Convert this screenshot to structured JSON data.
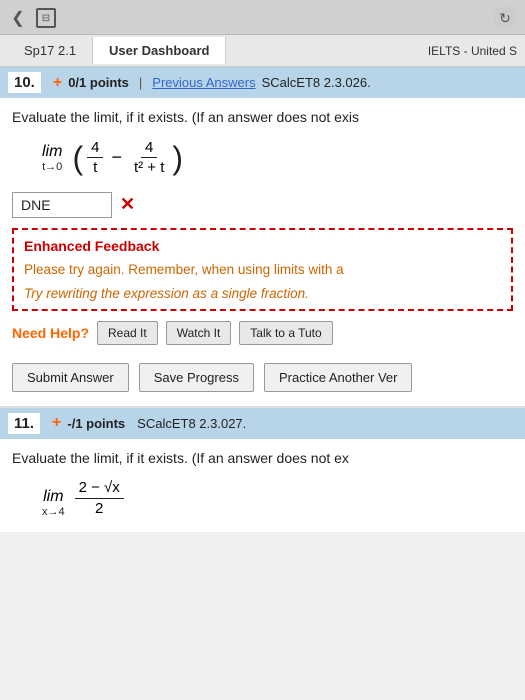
{
  "browser": {
    "back_icon": "❮",
    "tabs_icon": "⊞",
    "refresh_icon": "↻"
  },
  "nav": {
    "tab1": "Sp17 2.1",
    "tab2": "User Dashboard",
    "tab3": "IELTS - United S"
  },
  "question10": {
    "number": "10.",
    "plus_icon": "+",
    "points": "0/1 points",
    "divider": "|",
    "prev_answers_label": "Previous Answers",
    "source": "SCalcET8 2.3.026.",
    "question_text": "Evaluate the limit, if it exists. (If an answer does not exis",
    "lim_label": "lim",
    "lim_subscript": "t→0",
    "frac1_num": "4",
    "frac1_den": "t",
    "minus": "−",
    "frac2_num": "4",
    "frac2_den": "t² + t",
    "answer_value": "DNE",
    "wrong_mark": "✕",
    "feedback_title": "Enhanced Feedback",
    "feedback_text": "Please try again. Remember, when using limits with a",
    "feedback_hint": "Try rewriting the expression as a single fraction.",
    "need_help_label": "Need Help?",
    "btn_read": "Read It",
    "btn_watch": "Watch It",
    "btn_talk": "Talk to a Tuto",
    "btn_submit": "Submit Answer",
    "btn_save": "Save Progress",
    "btn_practice": "Practice Another Ver"
  },
  "question11": {
    "number": "11.",
    "plus_icon": "+",
    "points": "-/1 points",
    "source": "SCalcET8 2.3.027.",
    "question_text": "Evaluate the limit, if it exists. (If an answer does not ex",
    "lim_label": "lim",
    "lim_subscript": "x→4",
    "frac_num": "2 − √x",
    "frac_den_dot": "•",
    "frac_den_num": "2"
  }
}
